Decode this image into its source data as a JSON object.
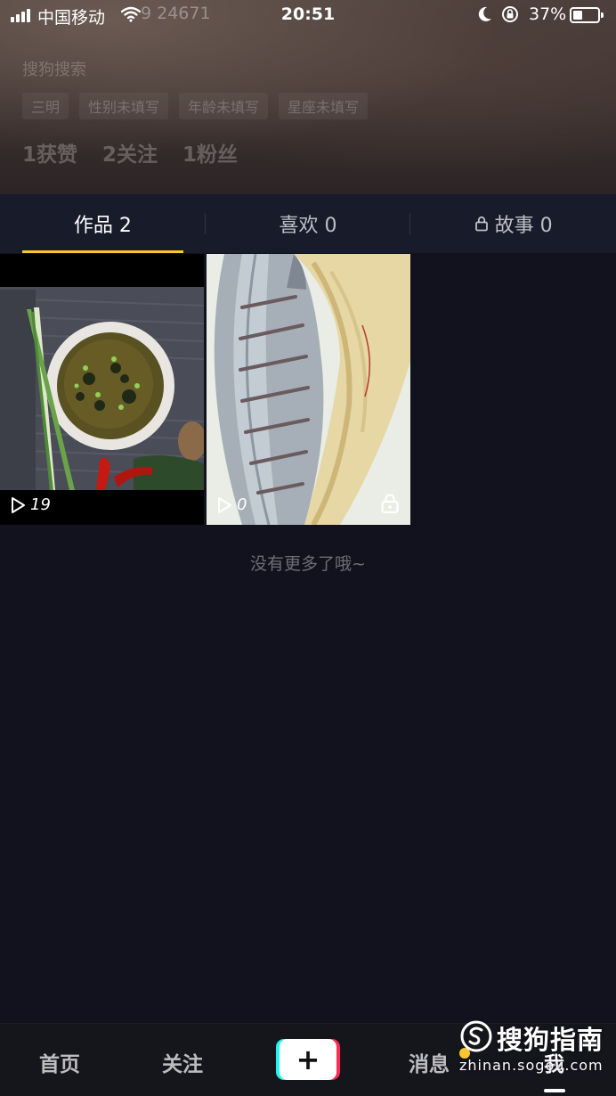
{
  "status_bar": {
    "carrier": "中国移动",
    "behind_text": "9 24671",
    "time": "20:51",
    "battery_percent": "37%",
    "battery_level": 0.37
  },
  "profile": {
    "search_hint": "搜狗搜索",
    "tags": [
      "三明",
      "性别未填写",
      "年龄未填写",
      "星座未填写"
    ],
    "stats": [
      "1获赞",
      "2关注",
      "1粉丝"
    ]
  },
  "tabs": [
    {
      "label": "作品 2",
      "active": true
    },
    {
      "label": "喜欢 0",
      "active": false
    },
    {
      "label": "故事 0",
      "active": false,
      "icon": "lock-icon"
    }
  ],
  "videos": [
    {
      "plays": "19",
      "thumbnail": "soup-and-scallions",
      "locked": false
    },
    {
      "plays": "0",
      "thumbnail": "scored-raw-fish",
      "locked": true
    }
  ],
  "end_message": "没有更多了哦~",
  "bottom_nav": {
    "home": "首页",
    "follow": "关注",
    "create": "+",
    "messages": "消息",
    "me": "我"
  },
  "watermark": {
    "name": "搜狗指南",
    "domain": "zhinan.sogou.com"
  },
  "colors": {
    "accent": "#f8c72d",
    "background": "#12121f",
    "tab_bar": "#181b2a",
    "cyan": "#25f4ee",
    "red": "#fe2c55"
  }
}
